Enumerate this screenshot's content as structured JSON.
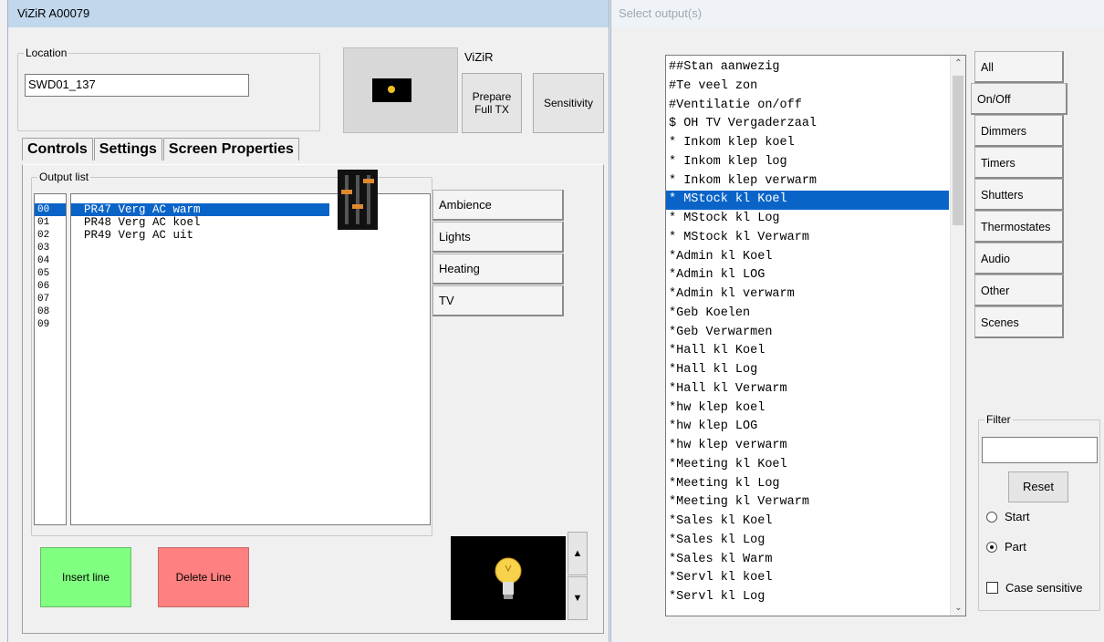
{
  "left_window": {
    "title": "ViZiR A00079",
    "location": {
      "legend": "Location",
      "value": "SWD01_137"
    },
    "vizir_label": "ViZiR",
    "prepare_button": [
      "Prepare",
      "Full TX"
    ],
    "sensitivity_button": "Sensitivity",
    "tabs": [
      "Controls",
      "Settings",
      "Screen Properties"
    ],
    "output_list": {
      "legend": "Output list",
      "numbers": [
        "00",
        "01",
        "02",
        "03",
        "04",
        "05",
        "06",
        "07",
        "08",
        "09"
      ],
      "items": [
        "PR47 Verg AC warm",
        "PR48 Verg AC koel",
        "PR49 Verg AC uit"
      ],
      "selected_index": 0
    },
    "category_tabs": [
      "Ambience",
      "Lights",
      "Heating",
      "TV"
    ],
    "insert_button": "Insert line",
    "delete_button": "Delete Line",
    "colors": {
      "insert": "#80ff80",
      "delete": "#ff8080",
      "selection": "#0a64c8"
    },
    "icons": [
      "sliders-icon",
      "lightbulb-icon",
      "triangle-up-icon",
      "triangle-down-icon"
    ]
  },
  "right_window": {
    "title": "Select output(s)",
    "outputs": [
      "##Stan aanwezig",
      "#Te veel zon",
      "#Ventilatie on/off",
      "$ OH TV Vergaderzaal",
      "* Inkom klep koel",
      "* Inkom klep log",
      "* Inkom klep verwarm",
      "* MStock kl Koel",
      "* MStock kl Log",
      "* MStock kl Verwarm",
      "*Admin kl Koel",
      "*Admin kl LOG",
      "*Admin kl verwarm",
      "*Geb Koelen",
      "*Geb Verwarmen",
      "*Hall kl Koel",
      "*Hall kl Log",
      "*Hall kl Verwarm",
      "*hw klep koel",
      "*hw klep LOG",
      "*hw klep verwarm",
      "*Meeting kl Koel",
      "*Meeting kl Log",
      "*Meeting kl Verwarm",
      "*Sales kl Koel",
      "*Sales kl Log",
      "*Sales kl Warm",
      "*Servl kl koel",
      "*Servl kl Log"
    ],
    "selected_output_index": 7,
    "type_tabs": [
      "All",
      "On/Off",
      "Dimmers",
      "Timers",
      "Shutters",
      "Thermostates",
      "Audio",
      "Other",
      "Scenes"
    ],
    "active_type_tab": 1,
    "filter": {
      "legend": "Filter",
      "value": "",
      "reset_label": "Reset",
      "start_label": "Start",
      "part_label": "Part",
      "selected_mode": "Part",
      "case_sensitive_label": "Case sensitive",
      "case_sensitive": false
    }
  }
}
